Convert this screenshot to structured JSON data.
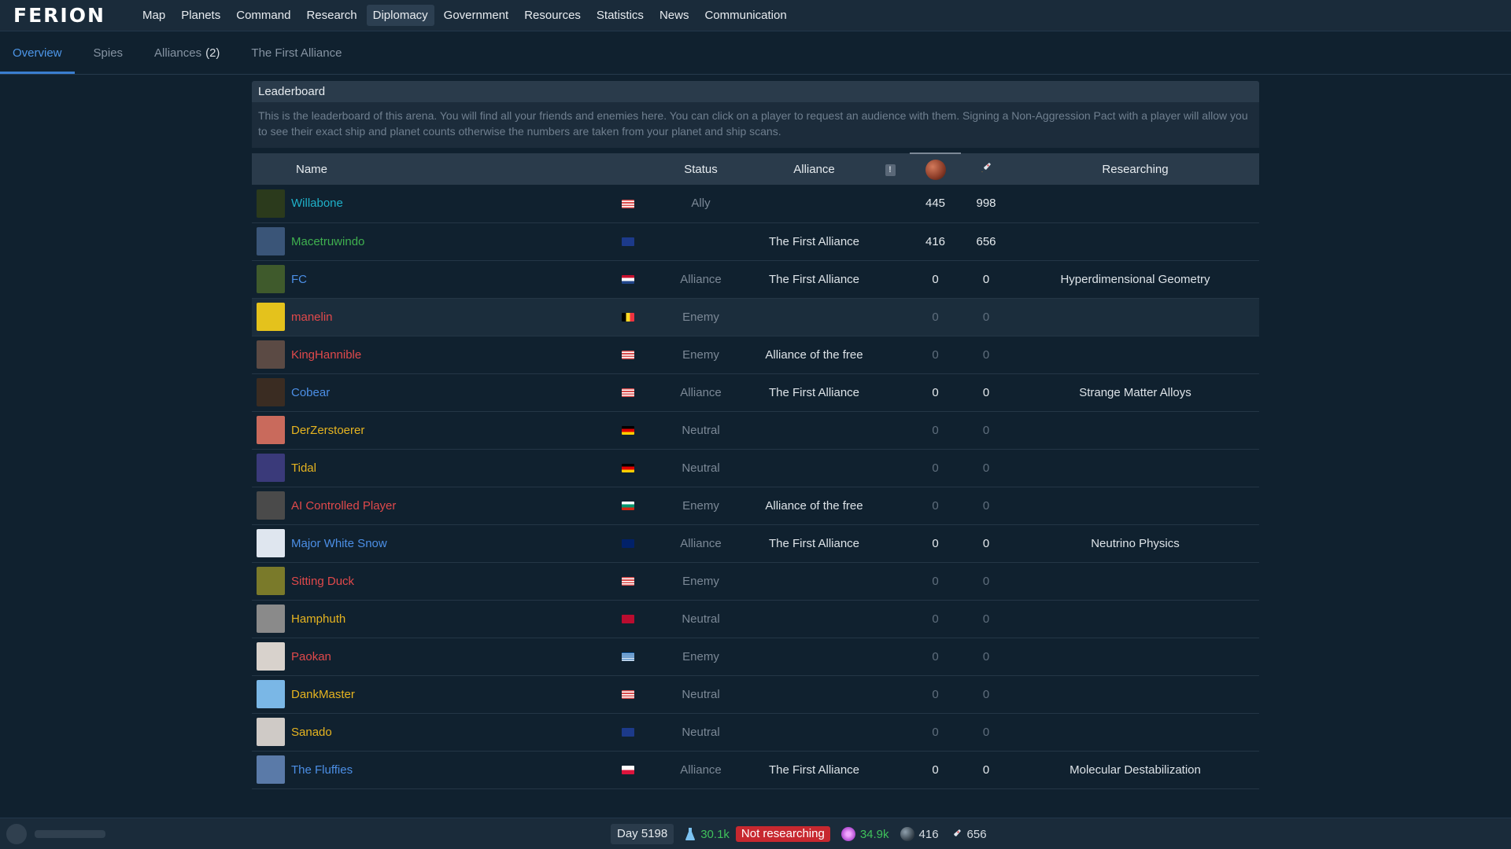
{
  "app": {
    "logo": "FERION"
  },
  "nav": [
    {
      "label": "Map",
      "active": false
    },
    {
      "label": "Planets",
      "active": false
    },
    {
      "label": "Command",
      "active": false
    },
    {
      "label": "Research",
      "active": false
    },
    {
      "label": "Diplomacy",
      "active": true
    },
    {
      "label": "Government",
      "active": false
    },
    {
      "label": "Resources",
      "active": false
    },
    {
      "label": "Statistics",
      "active": false
    },
    {
      "label": "News",
      "active": false
    },
    {
      "label": "Communication",
      "active": false
    }
  ],
  "subtabs": {
    "overview": "Overview",
    "spies": "Spies",
    "alliances": "Alliances",
    "alliances_count": "(2)",
    "first_alliance": "The First Alliance"
  },
  "leaderboard": {
    "title": "Leaderboard",
    "description": "This is the leaderboard of this arena. You will find all your friends and enemies here. You can click on a player to request an audience with them. Signing a Non-Aggression Pact with a player will allow you to see their exact ship and planet counts otherwise the numbers are taken from your planet and ship scans.",
    "headers": {
      "name": "Name",
      "status": "Status",
      "alliance": "Alliance",
      "info_icon": "!",
      "researching": "Researching"
    },
    "colors": {
      "ally": "#1fb1c9",
      "alliance_member": "#3fb04f",
      "alliance": "#4c8fe6",
      "enemy": "#e0494b",
      "neutral": "#e6b420"
    },
    "rows": [
      {
        "name": "Willabone",
        "flag": "us",
        "status": "Ally",
        "alliance": "",
        "planets": "445",
        "ships": "998",
        "research": "",
        "color": "#1fb1c9",
        "avatar": "#2b3a1c",
        "bright": true
      },
      {
        "name": "Macetruwindo",
        "flag": "au",
        "status": "",
        "alliance": "The First Alliance",
        "planets": "416",
        "ships": "656",
        "research": "",
        "color": "#3fb04f",
        "avatar": "#3a5578",
        "bright": true
      },
      {
        "name": "FC",
        "flag": "nl",
        "status": "Alliance",
        "alliance": "The First Alliance",
        "planets": "0",
        "ships": "0",
        "research": "Hyperdimensional Geometry",
        "color": "#4c8fe6",
        "avatar": "#3f5a2c",
        "bright": true
      },
      {
        "name": "manelin",
        "flag": "be",
        "status": "Enemy",
        "alliance": "",
        "planets": "0",
        "ships": "0",
        "research": "",
        "color": "#e0494b",
        "avatar": "#e4c21c",
        "bright": false
      },
      {
        "name": "KingHannible",
        "flag": "us",
        "status": "Enemy",
        "alliance": "Alliance of the free",
        "planets": "0",
        "ships": "0",
        "research": "",
        "color": "#e0494b",
        "avatar": "#5b4a44",
        "bright": false
      },
      {
        "name": "Cobear",
        "flag": "us",
        "status": "Alliance",
        "alliance": "The First Alliance",
        "planets": "0",
        "ships": "0",
        "research": "Strange Matter Alloys",
        "color": "#4c8fe6",
        "avatar": "#3a2c22",
        "bright": true
      },
      {
        "name": "DerZerstoerer",
        "flag": "de",
        "status": "Neutral",
        "alliance": "",
        "planets": "0",
        "ships": "0",
        "research": "",
        "color": "#e6b420",
        "avatar": "#c96a5c",
        "bright": false
      },
      {
        "name": "Tidal",
        "flag": "de",
        "status": "Neutral",
        "alliance": "",
        "planets": "0",
        "ships": "0",
        "research": "",
        "color": "#e6b420",
        "avatar": "#3a3a7a",
        "bright": false
      },
      {
        "name": "AI Controlled Player",
        "flag": "bg",
        "status": "Enemy",
        "alliance": "Alliance of the free",
        "planets": "0",
        "ships": "0",
        "research": "",
        "color": "#e0494b",
        "avatar": "#4a4a4a",
        "bright": false
      },
      {
        "name": "Major White Snow",
        "flag": "gb",
        "status": "Alliance",
        "alliance": "The First Alliance",
        "planets": "0",
        "ships": "0",
        "research": "Neutrino Physics",
        "color": "#4c8fe6",
        "avatar": "#dfe6ef",
        "bright": true
      },
      {
        "name": "Sitting Duck",
        "flag": "us",
        "status": "Enemy",
        "alliance": "",
        "planets": "0",
        "ships": "0",
        "research": "",
        "color": "#e0494b",
        "avatar": "#7a7a2a",
        "bright": false
      },
      {
        "name": "Hamphuth",
        "flag": "no",
        "status": "Neutral",
        "alliance": "",
        "planets": "0",
        "ships": "0",
        "research": "",
        "color": "#e6b420",
        "avatar": "#8a8a8a",
        "bright": false
      },
      {
        "name": "Paokan",
        "flag": "gr",
        "status": "Enemy",
        "alliance": "",
        "planets": "0",
        "ships": "0",
        "research": "",
        "color": "#e0494b",
        "avatar": "#d8d2cc",
        "bright": false
      },
      {
        "name": "DankMaster",
        "flag": "us",
        "status": "Neutral",
        "alliance": "",
        "planets": "0",
        "ships": "0",
        "research": "",
        "color": "#e6b420",
        "avatar": "#7ab7e6",
        "bright": false
      },
      {
        "name": "Sanado",
        "flag": "au",
        "status": "Neutral",
        "alliance": "",
        "planets": "0",
        "ships": "0",
        "research": "",
        "color": "#e6b420",
        "avatar": "#cfcac6",
        "bright": false
      },
      {
        "name": "The Fluffies",
        "flag": "pl",
        "status": "Alliance",
        "alliance": "The First Alliance",
        "planets": "0",
        "ships": "0",
        "research": "Molecular Destabilization",
        "color": "#4c8fe6",
        "avatar": "#5a7aa8",
        "bright": true
      }
    ]
  },
  "bottom": {
    "day": "Day 5198",
    "research_points": "30.1k",
    "not_researching": "Not researching",
    "crystal": "34.9k",
    "planets": "416",
    "ships": "656"
  }
}
